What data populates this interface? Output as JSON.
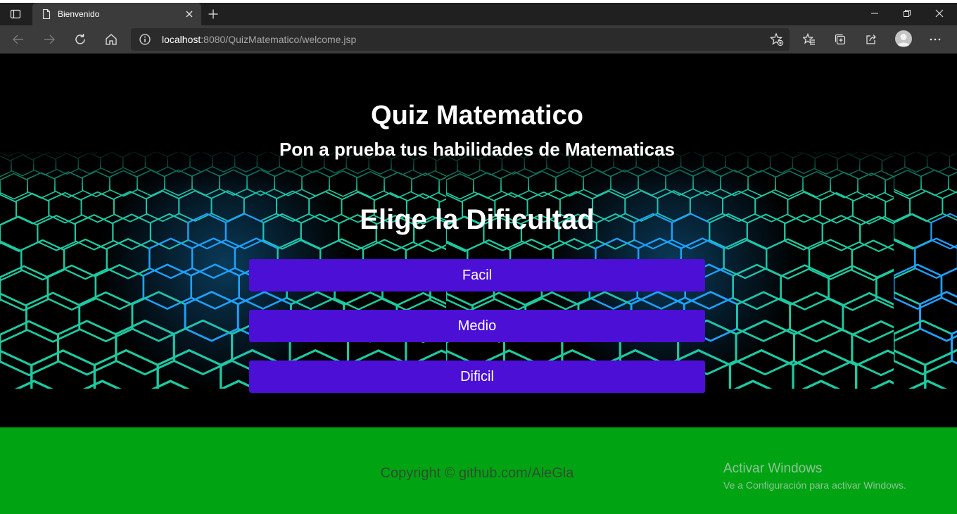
{
  "browser": {
    "tab_title": "Bienvenido",
    "url_host": "localhost",
    "url_rest": ":8080/QuizMatematico/welcome.jsp",
    "icons": [
      "tab-actions-icon",
      "page-favicon-icon",
      "close-icon",
      "plus-icon",
      "minimize-icon",
      "restore-icon",
      "close-window-icon",
      "back-icon",
      "forward-icon",
      "refresh-icon",
      "home-icon",
      "info-icon",
      "add-favorite-icon",
      "favorites-icon",
      "collections-icon",
      "share-icon",
      "profile-icon",
      "more-icon"
    ]
  },
  "page": {
    "title": "Quiz Matematico",
    "subtitle": "Pon a prueba tus habilidades de Matematicas",
    "difficulty_heading": "Elige la Dificultad",
    "buttons": {
      "easy": "Facil",
      "medium": "Medio",
      "hard": "Dificil"
    },
    "button_color": "#4b0fd6",
    "accent_grid_color": "#1ec9a0"
  },
  "footer": {
    "copyright": "Copyright © github.com/AleGla",
    "color": "#00a412"
  },
  "watermark": {
    "title": "Activar Windows",
    "subtitle": "Ve a Configuración para activar Windows."
  }
}
